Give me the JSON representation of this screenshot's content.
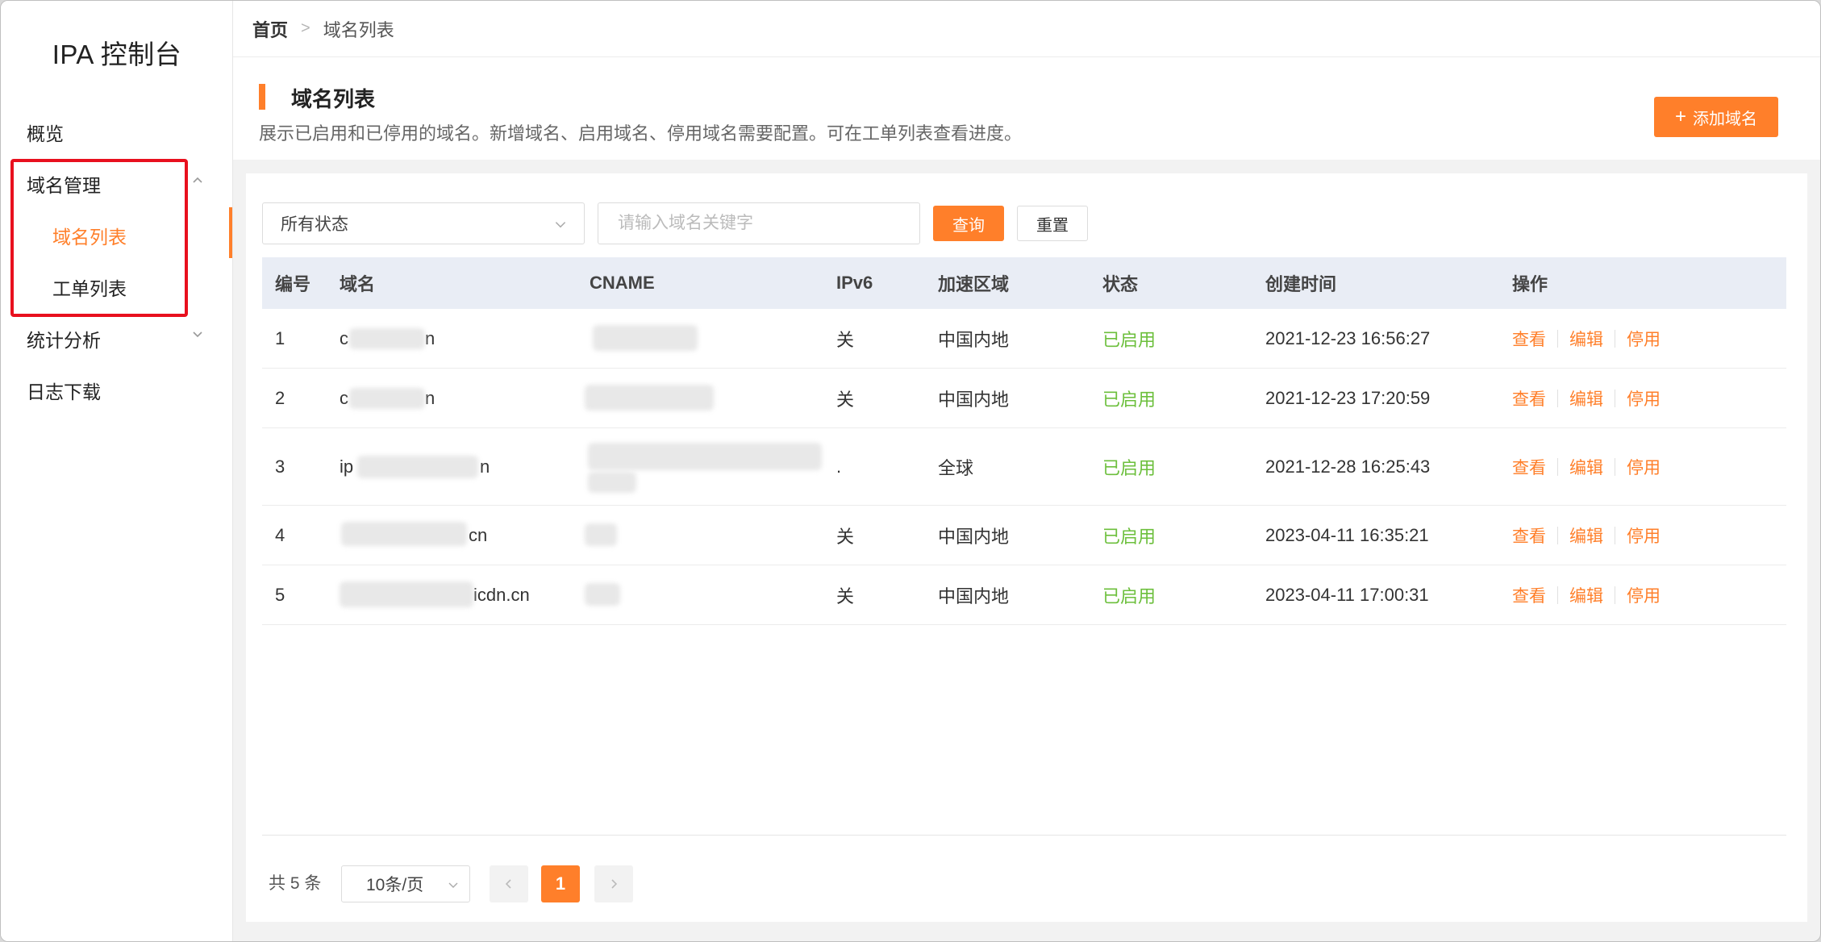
{
  "app": {
    "title": "IPA 控制台"
  },
  "sidebar": {
    "items": [
      {
        "label": "概览"
      },
      {
        "label": "域名管理"
      },
      {
        "label": "统计分析"
      },
      {
        "label": "日志下载"
      }
    ],
    "subitems": [
      {
        "label": "域名列表",
        "active": true
      },
      {
        "label": "工单列表"
      }
    ]
  },
  "breadcrumb": {
    "home": "首页",
    "separator": ">",
    "current": "域名列表"
  },
  "header": {
    "title": "域名列表",
    "description": "展示已启用和已停用的域名。新增域名、启用域名、停用域名需要配置。可在工单列表查看进度。",
    "add_button": "添加域名",
    "add_icon": "+"
  },
  "filters": {
    "status_selected": "所有状态",
    "search_placeholder": "请输入域名关键字",
    "search_value": "",
    "query_button": "查询",
    "reset_button": "重置"
  },
  "table": {
    "columns": [
      "编号",
      "域名",
      "CNAME",
      "IPv6",
      "加速区域",
      "状态",
      "创建时间",
      "操作"
    ],
    "rows": [
      {
        "id": "1",
        "domain": "c",
        "domain_suffix": "n",
        "cname": "",
        "ipv6": "关",
        "region": "中国内地",
        "status": "已启用",
        "created": "2021-12-23 16:56:27"
      },
      {
        "id": "2",
        "domain": "c",
        "domain_suffix": "n",
        "cname": "",
        "ipv6": "关",
        "region": "中国内地",
        "status": "已启用",
        "created": "2021-12-23 17:20:59"
      },
      {
        "id": "3",
        "domain": "ip",
        "domain_suffix": "n",
        "cname": "",
        "ipv6": ".",
        "region": "全球",
        "status": "已启用",
        "created": "2021-12-28 16:25:43"
      },
      {
        "id": "4",
        "domain": "",
        "domain_suffix": "cn",
        "cname": "",
        "ipv6": "关",
        "region": "中国内地",
        "status": "已启用",
        "created": "2023-04-11 16:35:21"
      },
      {
        "id": "5",
        "domain": "",
        "domain_suffix": "icdn.cn",
        "cname": "",
        "ipv6": "关",
        "region": "中国内地",
        "status": "已启用",
        "created": "2023-04-11 17:00:31"
      }
    ],
    "actions": [
      "查看",
      "编辑",
      "停用"
    ]
  },
  "pagination": {
    "total_text": "共 5 条",
    "page_size": "10条/页",
    "current_page": "1"
  },
  "colors": {
    "accent": "#ff7f2a",
    "status_enabled": "#6cbf3c",
    "highlight": "#e8101e"
  }
}
